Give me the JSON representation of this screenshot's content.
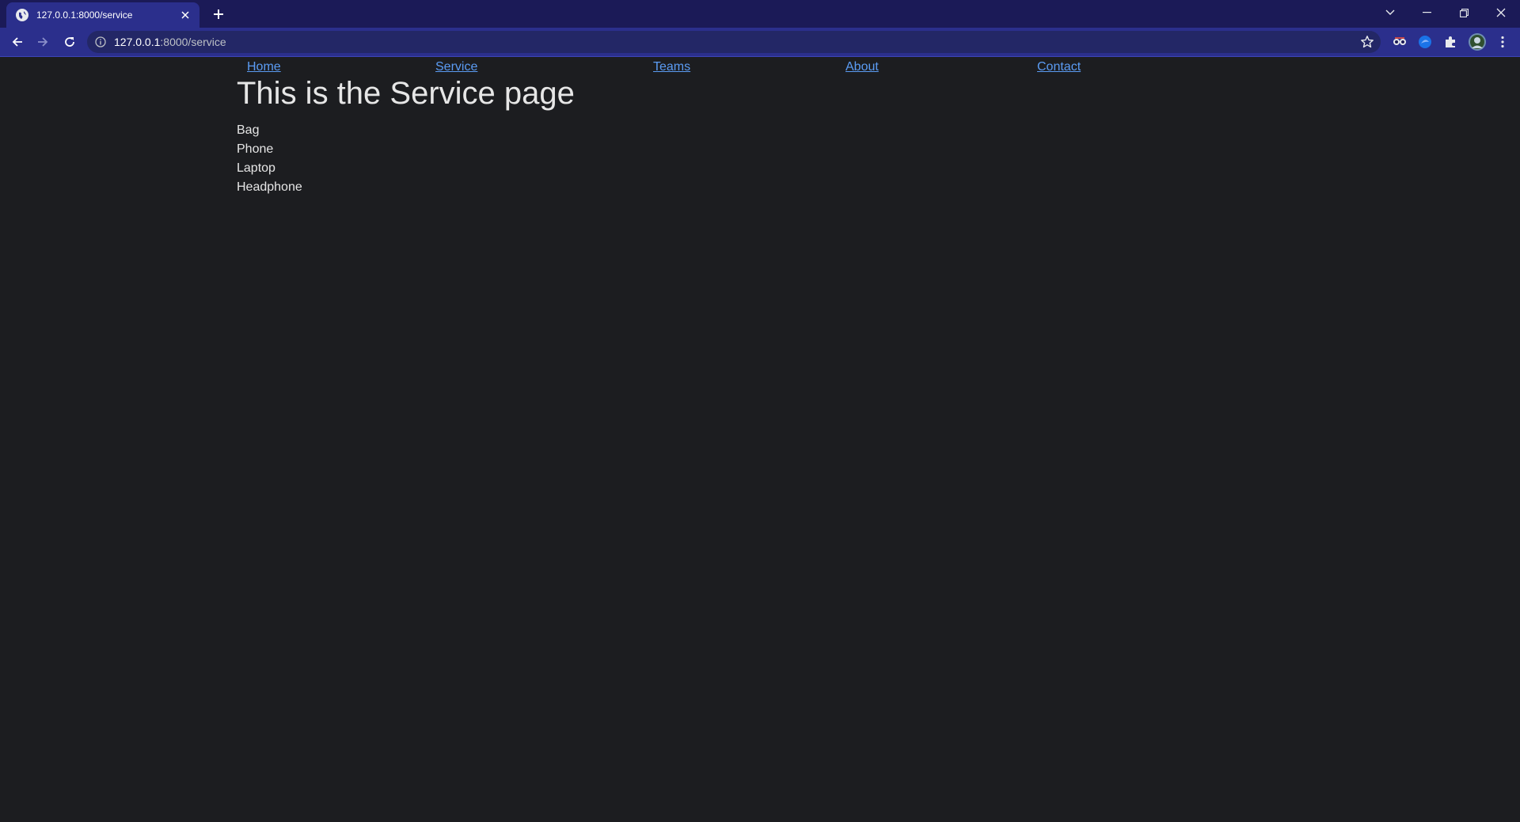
{
  "browser": {
    "tab_title": "127.0.0.1:8000/service",
    "url_host": "127.0.0.1",
    "url_rest": ":8000/service",
    "accent_color": "#2b2f8c",
    "tabstrip_color": "#1b1a57"
  },
  "nav": {
    "home": "Home",
    "service": "Service",
    "teams": "Teams",
    "about": "About",
    "contact": "Contact",
    "link_color": "#5b9cf4"
  },
  "main": {
    "title": "This is the Service page",
    "items": [
      "Bag",
      "Phone",
      "Laptop",
      "Headphone"
    ]
  },
  "icons": {
    "favicon": "globe-icon",
    "tab_close": "close-icon",
    "new_tab": "plus-icon",
    "tab_search": "chevron-down-icon",
    "minimize": "minimize-icon",
    "restore": "restore-icon",
    "close_window": "close-icon",
    "back": "arrow-left-icon",
    "forward": "arrow-right-icon",
    "reload": "reload-icon",
    "site_info": "info-icon",
    "bookmark": "star-icon",
    "extensions": "puzzle-icon",
    "profile": "avatar",
    "menu": "kebab-menu-icon"
  }
}
